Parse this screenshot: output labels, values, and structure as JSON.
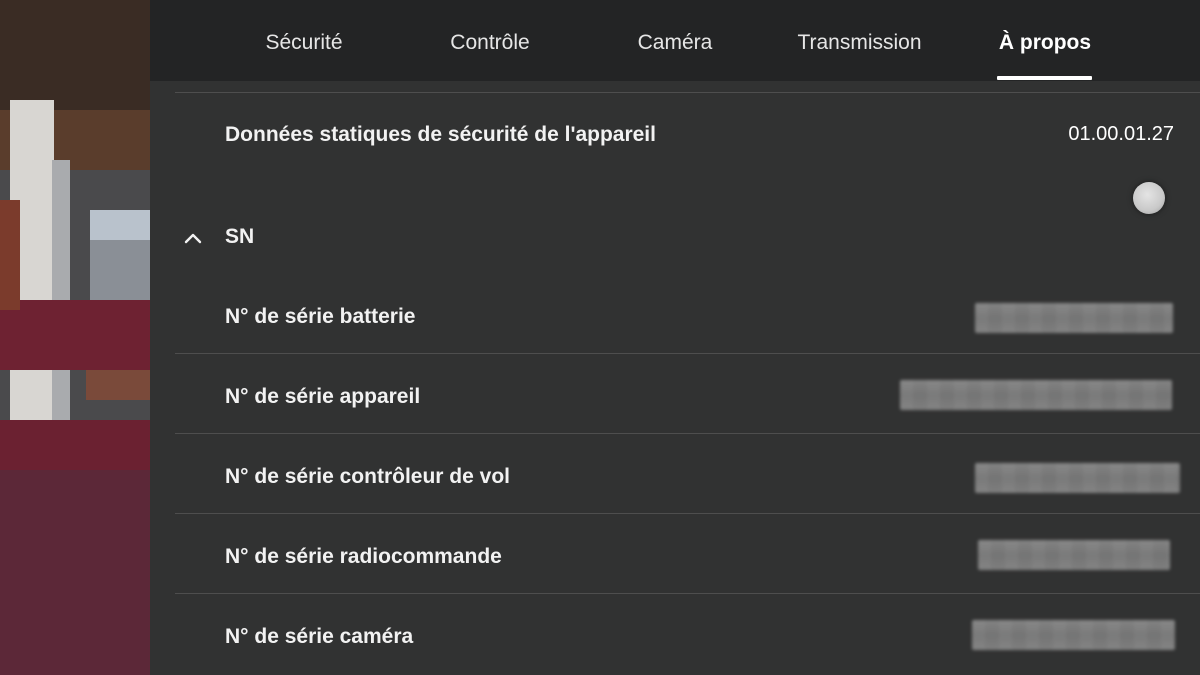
{
  "tabs": [
    {
      "label": "Sécurité",
      "active": false
    },
    {
      "label": "Contrôle",
      "active": false
    },
    {
      "label": "Caméra",
      "active": false
    },
    {
      "label": "Transmission",
      "active": false
    },
    {
      "label": "À propos",
      "active": true
    }
  ],
  "about": {
    "static_security_label": "Données statiques de sécurité de l'appareil",
    "static_security_value": "01.00.01.27",
    "sn_section_label": "SN",
    "sn_section_expanded": true,
    "sn_items": [
      {
        "label": "N° de série batterie",
        "value_hidden": true
      },
      {
        "label": "N° de série appareil",
        "value_hidden": true
      },
      {
        "label": "N° de série contrôleur de vol",
        "value_hidden": true
      },
      {
        "label": "N° de série radiocommande",
        "value_hidden": true
      },
      {
        "label": "N° de série caméra",
        "value_hidden": true
      }
    ]
  },
  "icons": {
    "collapse": "chevron-up-icon",
    "scroll": "scroll-handle"
  },
  "colors": {
    "active_tab": "#ffffff",
    "panel_bg": "#303132",
    "text": "#f2f2f2"
  }
}
